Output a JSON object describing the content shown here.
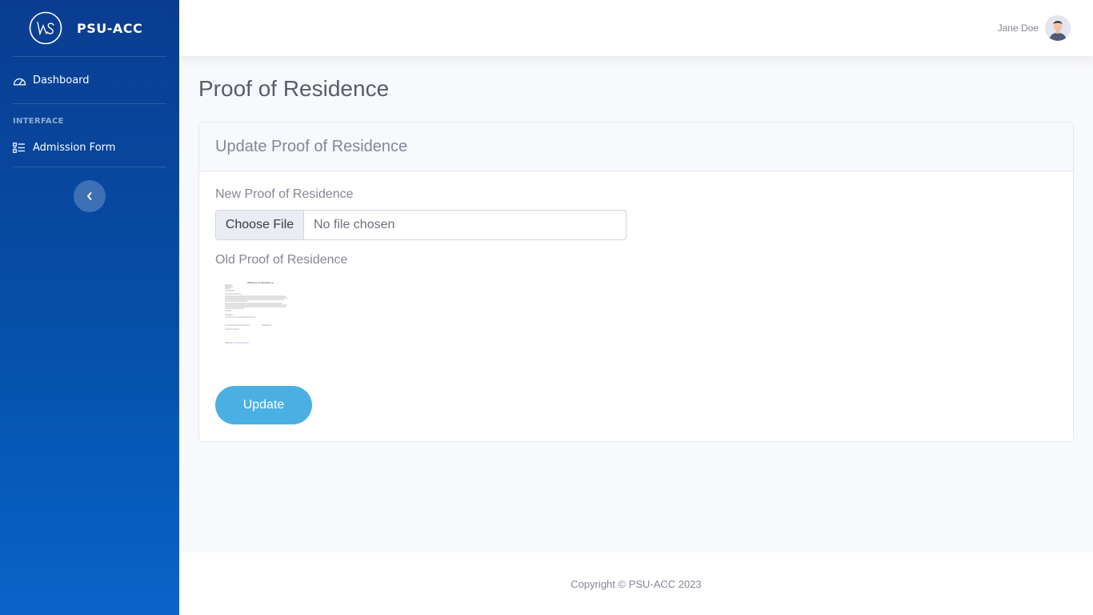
{
  "sidebar": {
    "brand_text": "PSU-ACC",
    "logo_letters": "WS",
    "items": [
      {
        "label": "Dashboard",
        "icon": "dashboard-gauge-icon"
      },
      {
        "label": "Admission Form",
        "icon": "list-checklist-icon"
      }
    ],
    "heading": "INTERFACE",
    "toggle_icon": "chevron-left-icon"
  },
  "topbar": {
    "user_name": "Jane Doe",
    "avatar_icon": "user-avatar-icon"
  },
  "main": {
    "page_title": "Proof of Residence",
    "card_title": "Update Proof of Residence",
    "new_label": "New Proof of Residence",
    "file_button": "Choose File",
    "file_status": "No file chosen",
    "old_label": "Old Proof of Residence",
    "document_preview_title": "Affidavit of Residence",
    "update_button": "Update"
  },
  "footer": {
    "copyright": "Copyright © PSU-ACC 2023"
  },
  "colors": {
    "sidebar_top": "#0a3d91",
    "sidebar_bottom": "#0a64c9",
    "update_button": "#4ab0e3",
    "background": "#f8f9fc"
  }
}
